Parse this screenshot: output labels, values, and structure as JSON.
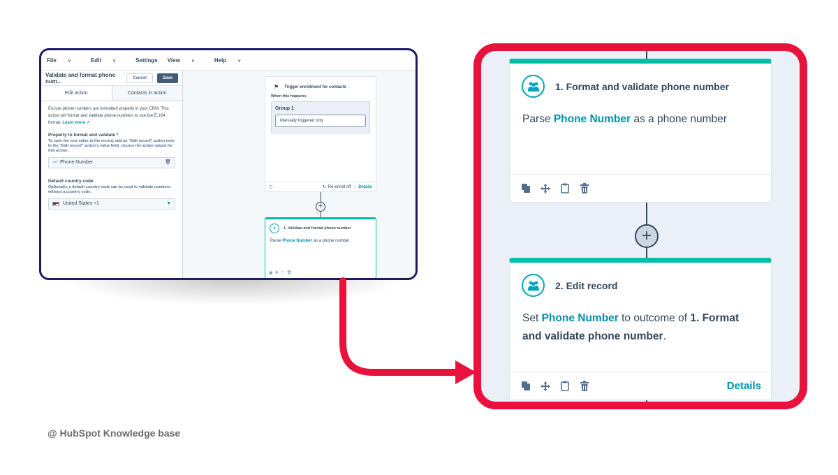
{
  "menubar": {
    "file": "File",
    "edit": "Edit",
    "settings": "Settings",
    "view": "View",
    "help": "Help",
    "chevron": "∨"
  },
  "left_panel": {
    "title": "Validate and format phone num...",
    "cancel_label": "Cancel",
    "save_label": "Save",
    "tabs": [
      "Edit action",
      "Contacts in action"
    ],
    "description": "Ensure phone numbers are formatted properly in your CRM. This action will format and validate phone numbers to use the E.164 format.",
    "learn_more": "Learn more",
    "property_label": "Property to format and validate *",
    "property_hint": "To save the new value to the record, add an \"Edit record\" action next. In the \"Edit record\" action's value field, choose the action output for this action.",
    "property_value": "Phone Number",
    "country_label": "Default country code",
    "country_hint": "Optionally, a default country code can be used to validate numbers without a country code.",
    "country_value": "United States +1"
  },
  "trigger_card": {
    "title": "Trigger enrollment for contacts",
    "when": "When this happens",
    "group": "Group 1",
    "criteria": "Manually triggered only",
    "reenroll": "Re-enroll off",
    "details": "Details"
  },
  "small_action": {
    "title": "1. Validate and format phone number",
    "body_pre": "Parse",
    "body_hl": "Phone Number",
    "body_post": "as a phone number"
  },
  "zoom": {
    "card1": {
      "title": "1. Format and validate phone number",
      "body_pre": "Parse ",
      "body_hl": "Phone Number",
      "body_post": " as a phone number"
    },
    "card2": {
      "title": "2. Edit record",
      "body_pre": "Set ",
      "body_hl": "Phone Number",
      "body_mid": " to outcome of ",
      "body_bold": "1. Format and validate phone number",
      "body_post": ".",
      "details": "Details"
    },
    "plus": "+"
  },
  "caption": "@ HubSpot Knowledge base",
  "colors": {
    "accent_teal": "#00bda5",
    "link_teal": "#0091ae",
    "highlight_red": "#e8123c",
    "frame_navy": "#1e1b5e"
  }
}
